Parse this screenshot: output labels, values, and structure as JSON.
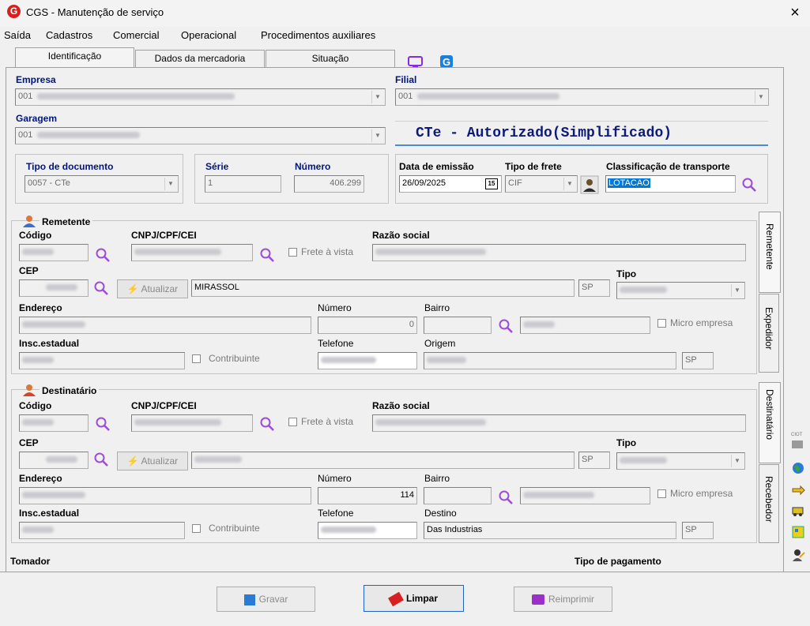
{
  "window": {
    "title": "CGS - Manutenção de serviço",
    "logo_letter": "G",
    "close": "×"
  },
  "menu": [
    "Saída",
    "Cadastros",
    "Comercial",
    "Operacional",
    "Procedimentos auxiliares"
  ],
  "tabs": [
    "Identificação",
    "Dados da mercadoria",
    "Situação"
  ],
  "ident": {
    "empresa_label": "Empresa",
    "empresa_value": "001",
    "filial_label": "Filial",
    "filial_value": "001",
    "garagem_label": "Garagem",
    "garagem_value": "001",
    "status_text": "CTe - Autorizado(Simplificado)",
    "tipo_doc_label": "Tipo de documento",
    "tipo_doc_value": "0057 - CTe",
    "serie_label": "Série",
    "serie_value": "1",
    "numero_label": "Número",
    "numero_value": "406.299",
    "data_emissao_label": "Data de emissão",
    "data_emissao_value": "26/09/2025",
    "cal_day": "15",
    "tipo_frete_label": "Tipo de frete",
    "tipo_frete_value": "CIF",
    "class_transp_label": "Classificação de transporte",
    "class_transp_value": "LOTACAO"
  },
  "remetente": {
    "title": "Remetente",
    "codigo_label": "Código",
    "cnpj_label": "CNPJ/CPF/CEI",
    "frete_vista": "Frete à vista",
    "razao_label": "Razão social",
    "cep_label": "CEP",
    "atualizar": "Atualizar",
    "cidade": "MIRASSOL",
    "uf": "SP",
    "tipo_label": "Tipo",
    "endereco_label": "Endereço",
    "numero_label": "Número",
    "numero_value": "0",
    "bairro_label": "Bairro",
    "micro_empresa": "Micro empresa",
    "insc_label": "Insc.estadual",
    "contribuinte": "Contribuinte",
    "telefone_label": "Telefone",
    "origem_label": "Origem",
    "origem_uf": "SP"
  },
  "destinatario": {
    "title": "Destinatário",
    "codigo_label": "Código",
    "cnpj_label": "CNPJ/CPF/CEI",
    "frete_vista": "Frete à vista",
    "razao_label": "Razão social",
    "cep_label": "CEP",
    "atualizar": "Atualizar",
    "uf": "SP",
    "tipo_label": "Tipo",
    "endereco_label": "Endereço",
    "numero_label": "Número",
    "numero_value": "114",
    "bairro_label": "Bairro",
    "micro_empresa": "Micro empresa",
    "insc_label": "Insc.estadual",
    "contribuinte": "Contribuinte",
    "telefone_label": "Telefone",
    "destino_label": "Destino",
    "destino_value": "Das Industrias",
    "destino_uf": "SP"
  },
  "side_tabs": [
    "Remetente",
    "Expedidor",
    "Destinatário",
    "Recebedor"
  ],
  "bottom": {
    "tomador": "Tomador",
    "tipo_pagamento": "Tipo de pagamento"
  },
  "buttons": {
    "gravar": "Gravar",
    "limpar": "Limpar",
    "reimprimir": "Reimprimir"
  },
  "right_icons": {
    "ciot": "CIOT"
  },
  "colors": {
    "label_blue": "#00157d",
    "accent_red": "#d62020",
    "status_blue": "#0c1a7a",
    "selection": "#0078d7"
  }
}
